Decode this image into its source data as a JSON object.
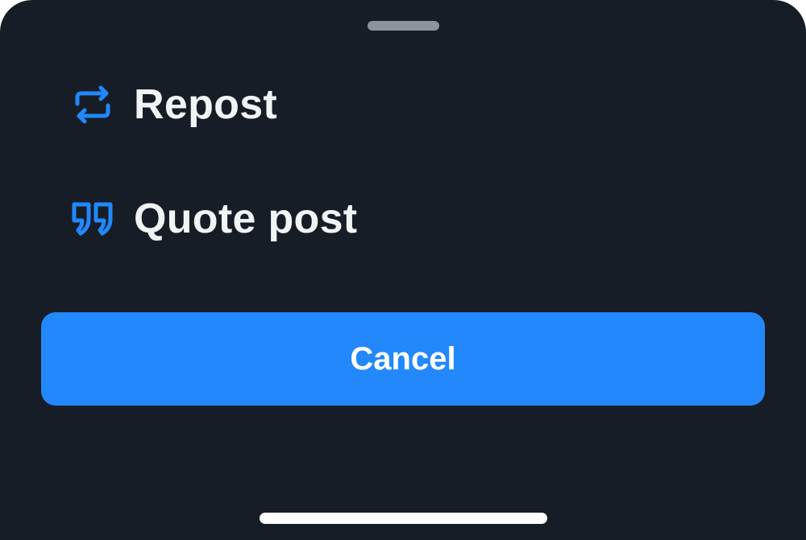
{
  "sheet": {
    "background": "#171d26",
    "accent": "#2288fb",
    "items": [
      {
        "label": "Repost",
        "icon": "repost-icon"
      },
      {
        "label": "Quote post",
        "icon": "quote-icon"
      }
    ],
    "cancel_label": "Cancel"
  }
}
